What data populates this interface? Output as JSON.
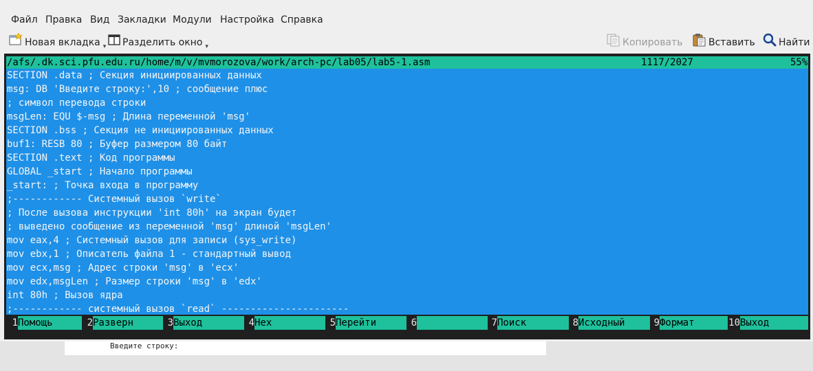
{
  "menubar": {
    "items": [
      "Файл",
      "Правка",
      "Вид",
      "Закладки",
      "Модули",
      "Настройка",
      "Справка"
    ]
  },
  "toolbar": {
    "new_tab": "Новая вкладка",
    "split": "Разделить окно",
    "copy": "Копировать",
    "paste": "Вставить",
    "find": "Найти"
  },
  "editor": {
    "path": "/afs/.dk.sci.pfu.edu.ru/home/m/v/mvmorozova/work/arch-pc/lab05/lab5-1.asm",
    "position": "1117/2027",
    "percent": "55%",
    "lines": [
      "SECTION .data ; Секция инициированных данных",
      "msg: DB 'Введите строку:',10 ; сообщение плюс",
      "; символ перевода строки",
      "msgLen: EQU $-msg ; Длина переменной 'msg'",
      "SECTION .bss ; Секция не инициированных данных",
      "buf1: RESB 80 ; Буфер размером 80 байт",
      "SECTION .text ; Код программы",
      "GLOBAL _start ; Начало программы",
      "_start: ; Точка входа в программу",
      ";------------ Системный вызов `write`",
      "; После вызова инструкции 'int 80h' на экран будет",
      "; выведено сообщение из переменной 'msg' длиной 'msgLen'",
      "mov eax,4 ; Системный вызов для записи (sys_write)",
      "mov ebx,1 ; Описатель файла 1 - стандартный вывод",
      "mov ecx,msg ; Адрес строки 'msg' в 'ecx'",
      "mov edx,msgLen ; Размер строки 'msg' в 'edx'",
      "int 80h ; Вызов ядра",
      ";------------ системный вызов `read` ----------------------"
    ]
  },
  "keybar": [
    {
      "num": "1",
      "label": "Помощь"
    },
    {
      "num": "2",
      "label": "Разверн"
    },
    {
      "num": "3",
      "label": "Выход"
    },
    {
      "num": "4",
      "label": "Hex"
    },
    {
      "num": "5",
      "label": "Перейти"
    },
    {
      "num": "6",
      "label": ""
    },
    {
      "num": "7",
      "label": "Поиск"
    },
    {
      "num": "8",
      "label": "Исходный"
    },
    {
      "num": "9",
      "label": "Формат"
    },
    {
      "num": "10",
      "label": "Выход"
    }
  ],
  "below": {
    "text": "Введите строку:"
  },
  "colors": {
    "editor_bg": "#1e90e8",
    "status_bg": "#1ec19c",
    "terminal_bg": "#1f1f1f"
  }
}
